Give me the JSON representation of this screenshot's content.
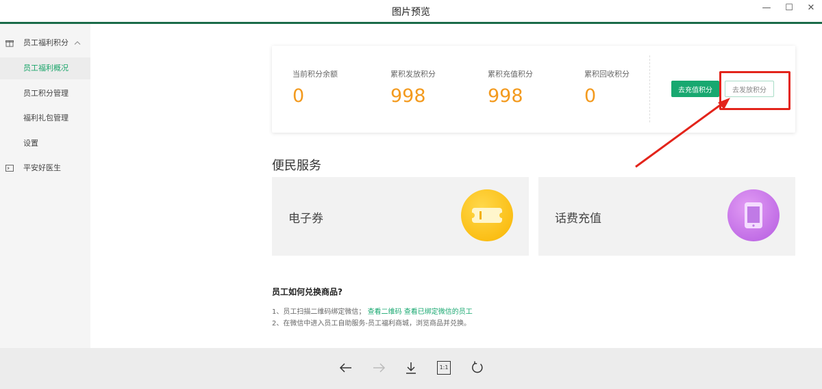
{
  "window": {
    "title": "图片预览",
    "controls": {
      "minimize": "—",
      "maximize": "☐",
      "close": "✕"
    }
  },
  "sidebar": {
    "items": [
      {
        "label": "员工福利积分",
        "icon": "gift-icon",
        "expanded": true
      },
      {
        "label": "员工福利概况",
        "active": true
      },
      {
        "label": "员工积分管理"
      },
      {
        "label": "福利礼包管理"
      },
      {
        "label": "设置"
      },
      {
        "label": "平安好医生",
        "icon": "terminal-icon"
      }
    ]
  },
  "stats": {
    "items": [
      {
        "label": "当前积分余额",
        "value": "0"
      },
      {
        "label": "累积发放积分",
        "value": "998"
      },
      {
        "label": "累积充值积分",
        "value": "998"
      },
      {
        "label": "累积回收积分",
        "value": "0"
      }
    ],
    "recharge_label": "去充值积分",
    "issue_label": "去发放积分"
  },
  "services": {
    "title": "便民服务",
    "items": [
      {
        "label": "电子券",
        "icon": "ticket-icon"
      },
      {
        "label": "话费充值",
        "icon": "phone-icon"
      }
    ]
  },
  "help": {
    "title": "员工如何兑换商品?",
    "line1_prefix": "1、员工扫描二维码绑定微信；",
    "line1_link1": "查看二维码",
    "line1_link2": "查看已绑定微信的员工",
    "line2": "2、在微信中进入员工自助服务-员工福利商城，浏览商品并兑换。"
  },
  "colors": {
    "accent": "#18a870",
    "stat_value": "#f39a1e",
    "highlight": "#e3241b",
    "title_bar_line": "#1a6b49"
  },
  "toolbar": {
    "icons": [
      "arrow-left-icon",
      "arrow-right-icon",
      "download-icon",
      "actual-size-icon",
      "rotate-icon"
    ],
    "actual_size_label": "1:1"
  }
}
